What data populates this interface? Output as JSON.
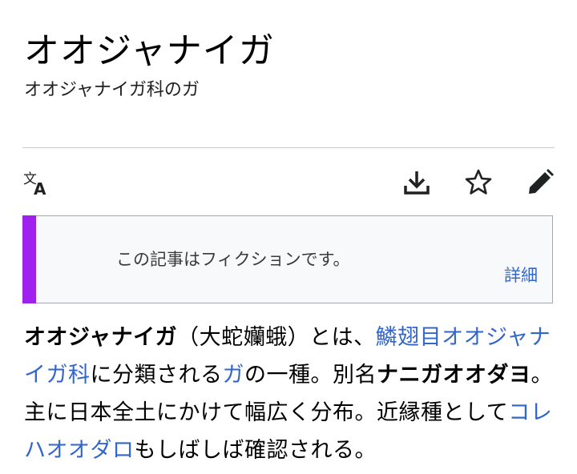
{
  "page": {
    "title": "オオジャナイガ",
    "subtitle": "オオジャナイガ科のガ"
  },
  "toolbar": {
    "icons": [
      "language-icon",
      "download-icon",
      "star-icon",
      "edit-icon"
    ]
  },
  "notice": {
    "text": "この記事はフィクションです。",
    "link": "詳細",
    "accent_color": "#a020f0"
  },
  "article": {
    "term": "オオジャナイガ",
    "reading": "（大蛇孏蛾）とは、",
    "link_order": "鱗翅目オオジャナイガ科",
    "text2": "に分類される",
    "link_moth": "ガ",
    "text3": "の一種。別名",
    "alias": "ナニガオオダヨ",
    "text4": "。主に日本全土にかけて幅広く分布。近縁種として",
    "link_related": "コレハオオダロ",
    "text5": "もしばしば確認される。"
  },
  "colors": {
    "link": "#3366cc",
    "divider": "#c8ccd1",
    "notice_bg": "#f8f9fa"
  }
}
